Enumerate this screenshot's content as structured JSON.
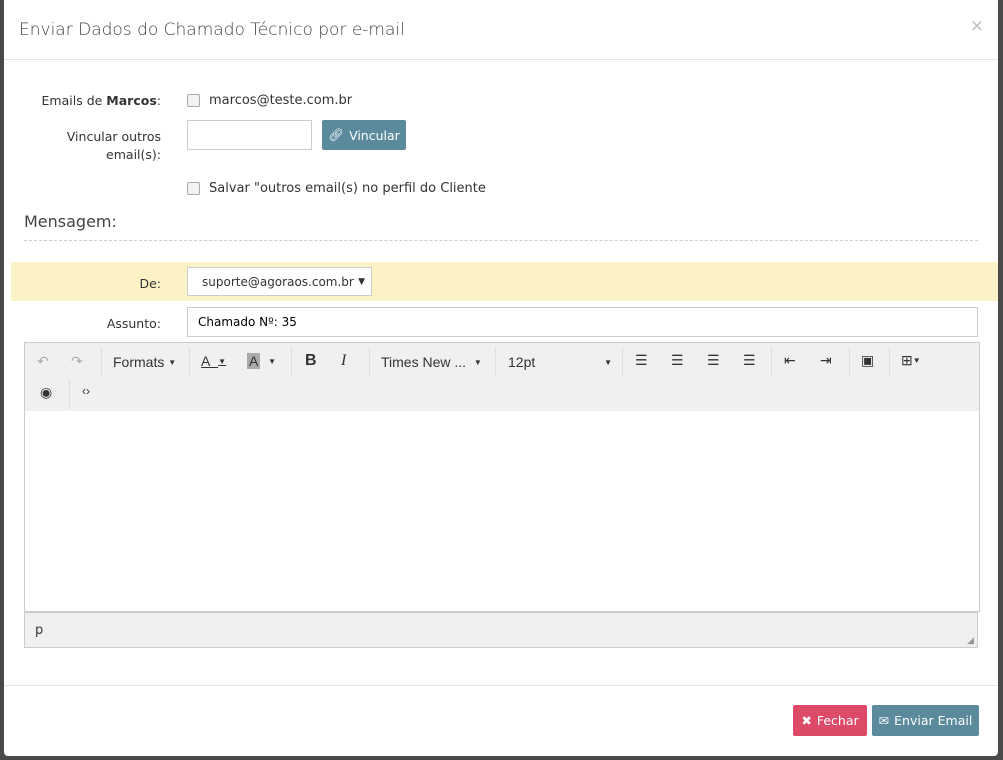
{
  "modal": {
    "title": "Enviar Dados do Chamado Técnico por e-mail",
    "close": "×"
  },
  "form": {
    "emails_label_prefix": "Emails de ",
    "emails_label_name": "Marcos",
    "emails_label_suffix": ":",
    "email_option": "marcos@teste.com.br",
    "vincular_label_1": "Vincular outros",
    "vincular_label_2": "email(s):",
    "vincular_value": "",
    "vincular_button": "Vincular",
    "salvar_label": "Salvar \"outros email(s) no perfil do Cliente",
    "mensagem_heading": "Mensagem:",
    "de_label": "De:",
    "de_value": "suporte@agoraos.com.br",
    "assunto_label": "Assunto:",
    "assunto_value": "Chamado Nº: 35"
  },
  "editor": {
    "formats": "Formats",
    "font": "Times New ...",
    "size": "12pt",
    "status_path": "p",
    "body": ""
  },
  "footer": {
    "close_button": "Fechar",
    "send_button": "Enviar Email"
  },
  "colors": {
    "danger": "#dc4a68",
    "primary": "#5a8a9c",
    "highlight": "#fbf3c5"
  }
}
